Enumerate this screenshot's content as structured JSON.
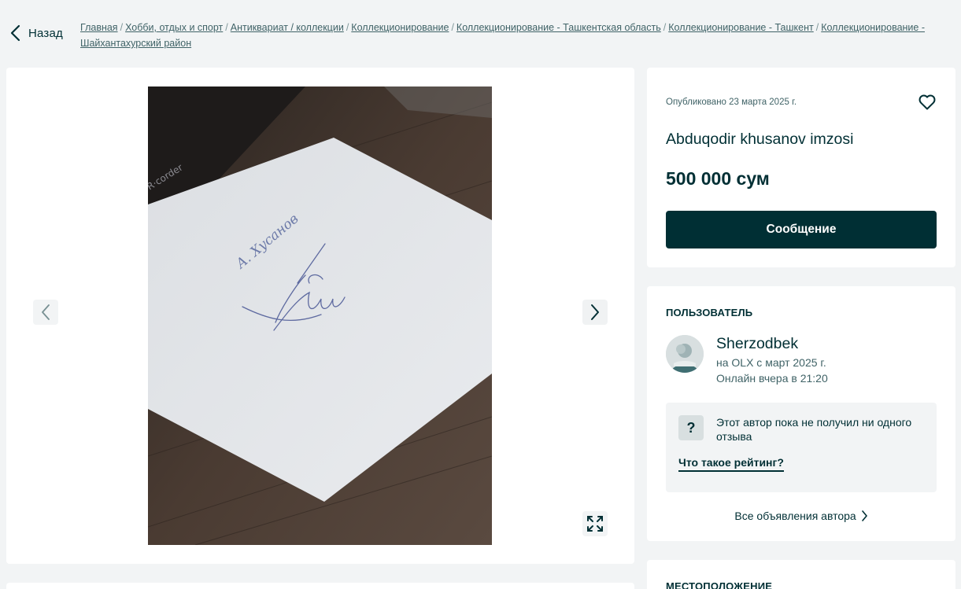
{
  "nav": {
    "back_label": "Назад"
  },
  "breadcrumb": [
    "Главная",
    "Хобби, отдых и спорт",
    "Антиквариат / коллекции",
    "Коллекционирование",
    "Коллекционирование - Ташкентская область",
    "Коллекционирование - Ташкент",
    "Коллекционирование - Шайхантахурский район"
  ],
  "breadcrumb_separator": "/",
  "listing": {
    "published": "Опубликовано 23 марта 2025 г.",
    "title": "Abduqodir khusanov imzosi",
    "price": "500 000 сум",
    "message_button": "Сообщение"
  },
  "photo": {
    "handwritten_name": "А. Хусанов",
    "corner_text": "R·corder"
  },
  "user": {
    "section_label": "ПОЛЬЗОВАТЕЛЬ",
    "name": "Sherzodbek",
    "member_since": "на OLX с март 2025 г.",
    "online_status": "Онлайн вчера в 21:20",
    "rating_text": "Этот автор пока не получил ни одного отзыва",
    "rating_link": "Что такое рейтинг?",
    "all_ads_link": "Все объявления автора"
  },
  "location": {
    "section_label": "МЕСТОПОЛОЖЕНИЕ"
  },
  "colors": {
    "primary": "#002f34",
    "background": "#f2f4f5",
    "muted_text": "#406367"
  },
  "icons": [
    "chevron-left-icon",
    "chevron-right-icon",
    "heart-icon",
    "expand-icon",
    "question-icon",
    "avatar-icon"
  ]
}
